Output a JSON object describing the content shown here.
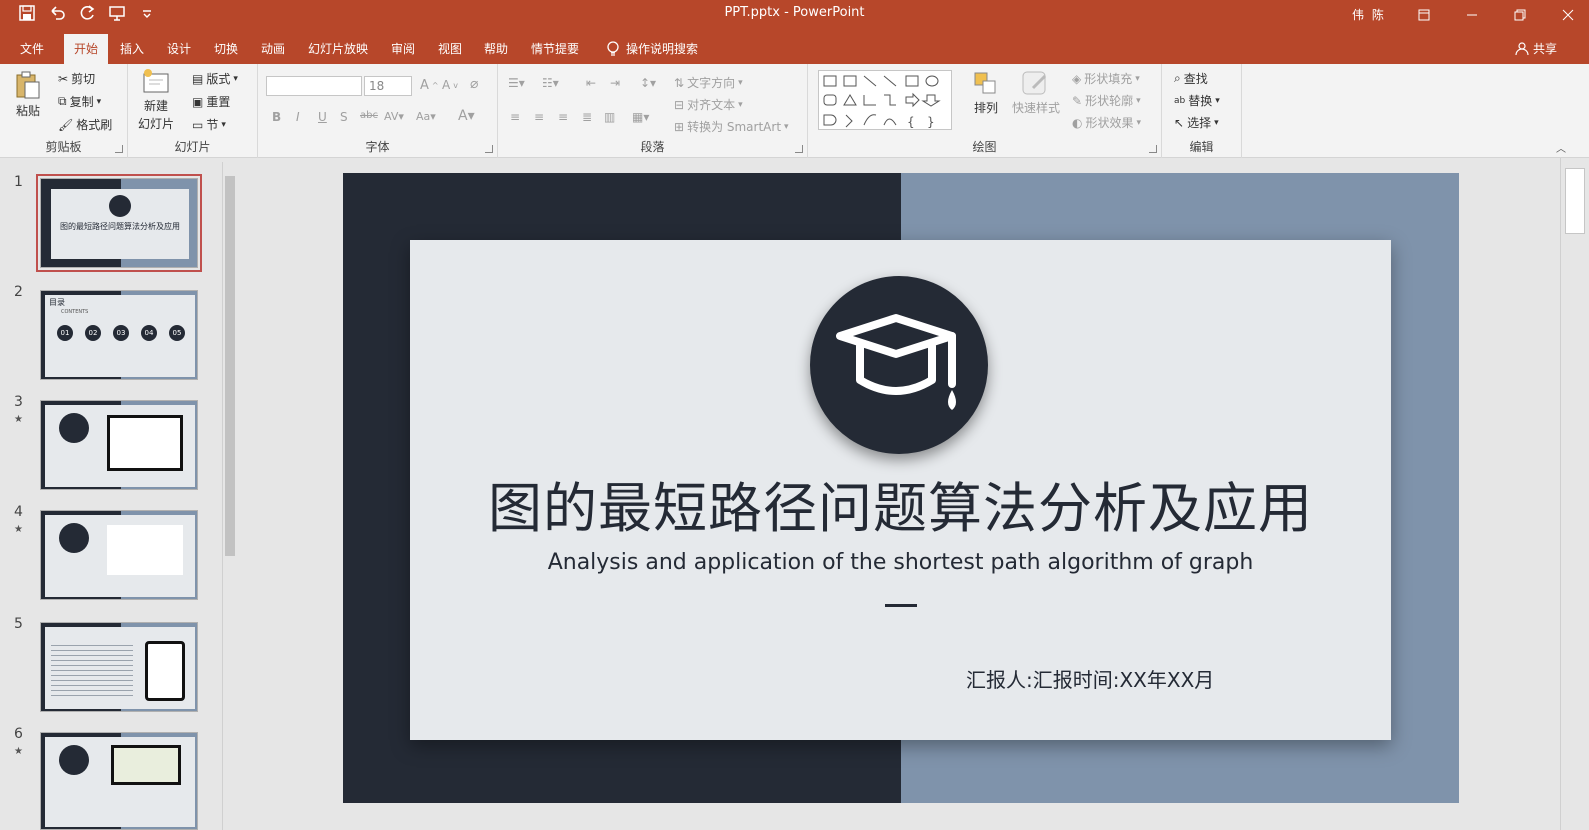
{
  "window": {
    "title": "PPT.pptx  -  PowerPoint",
    "user": "伟 陈"
  },
  "menu": {
    "file": "文件",
    "home": "开始",
    "insert": "插入",
    "design": "设计",
    "transitions": "切换",
    "animations": "动画",
    "slideshow": "幻灯片放映",
    "review": "审阅",
    "view": "视图",
    "help": "帮助",
    "storyline": "情节提要",
    "tell_me": "操作说明搜索",
    "share": "共享"
  },
  "ribbon": {
    "clipboard": {
      "label": "剪贴板",
      "paste": "粘贴",
      "cut": "剪切",
      "copy": "复制",
      "format_painter": "格式刷"
    },
    "slides": {
      "label": "幻灯片",
      "new_slide_1": "新建",
      "new_slide_2": "幻灯片",
      "layout": "版式",
      "reset": "重置",
      "section": "节"
    },
    "font": {
      "label": "字体",
      "size": "18"
    },
    "paragraph": {
      "label": "段落",
      "text_direction": "文字方向",
      "align_text": "对齐文本",
      "convert_smartart": "转换为 SmartArt"
    },
    "drawing": {
      "label": "绘图",
      "arrange": "排列",
      "quick_styles": "快速样式",
      "shape_fill": "形状填充",
      "shape_outline": "形状轮廓",
      "shape_effects": "形状效果"
    },
    "editing": {
      "label": "编辑",
      "find": "查找",
      "replace": "替换",
      "select": "选择"
    }
  },
  "thumbnails": [
    {
      "num": "1",
      "star": false,
      "selected": true
    },
    {
      "num": "2",
      "star": false,
      "selected": false
    },
    {
      "num": "3",
      "star": true,
      "selected": false
    },
    {
      "num": "4",
      "star": true,
      "selected": false
    },
    {
      "num": "5",
      "star": false,
      "selected": false
    },
    {
      "num": "6",
      "star": true,
      "selected": false
    }
  ],
  "thumb_text": {
    "t1_title": "图的最短路径问题算法分析及应用",
    "t2_title": "目录",
    "t2_sub": "CONTENTS",
    "t2_nums": [
      "01",
      "02",
      "03",
      "04",
      "05"
    ]
  },
  "slide": {
    "title": "图的最短路径问题算法分析及应用",
    "subtitle": "Analysis and application of the shortest path algorithm of graph",
    "reporter": "汇报人:汇报时间:XX年XX月",
    "colors": {
      "dark": "#242a35",
      "accent": "#7f93ab",
      "panel": "#e6e9ec"
    }
  }
}
